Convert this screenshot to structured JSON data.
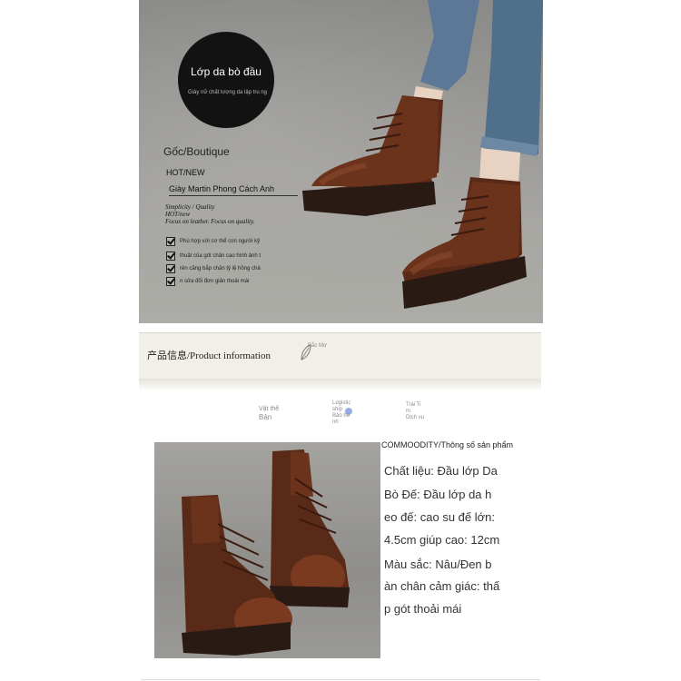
{
  "hero": {
    "badge_title": "Lớp da bò đầu",
    "badge_sub": "Giày nữ chất lượng da lập tru ng",
    "origin": "Gốc/Boutique",
    "hot_new": "HOT/NEW",
    "model": "Giày Martin Phong Cách Anh",
    "slogan_1": "Simplicity / Quality",
    "slogan_2": "HOT/new",
    "slogan_3": "Focus on leather. Focus on quality.",
    "features": [
      "Phù hợp với cơ thể con người kỹ",
      "thuật của gót chân cao hình ảnh t",
      "rên căng bắp chân tỷ lệ hồng chả",
      "n sửa đổi đơn giản thoải mái"
    ]
  },
  "product_info": {
    "title": "产品信息/Product information",
    "small": "Bắc Mơ"
  },
  "tabs": [
    {
      "line1": "Vật thể",
      "line2": "Bản"
    },
    {
      "line1": "Logistic",
      "line2": "ship",
      "line3": "Bảo hà",
      "line4": "nh"
    },
    {
      "line1": "Trái Ti",
      "line2": "m",
      "line3": "Dịch vụ"
    }
  ],
  "specs": {
    "heading": "COMMOODITY/Thông số sản phẩm",
    "lines": [
      "Chất liệu: Đầu lớp Da",
      "Bò Đế: Đầu lớp da h",
      "eo đế: cao su đế lớn:",
      "4.5cm giúp cao: 12cm",
      "Màu sắc: Nâu/Đen b",
      "àn chân cảm giác: thấ",
      "p gót thoải mái"
    ]
  },
  "colors": {
    "leather": "#5a2a18",
    "leather_light": "#8a4a2a",
    "sole": "#2a1a14",
    "denim": "#4f6f8a"
  }
}
